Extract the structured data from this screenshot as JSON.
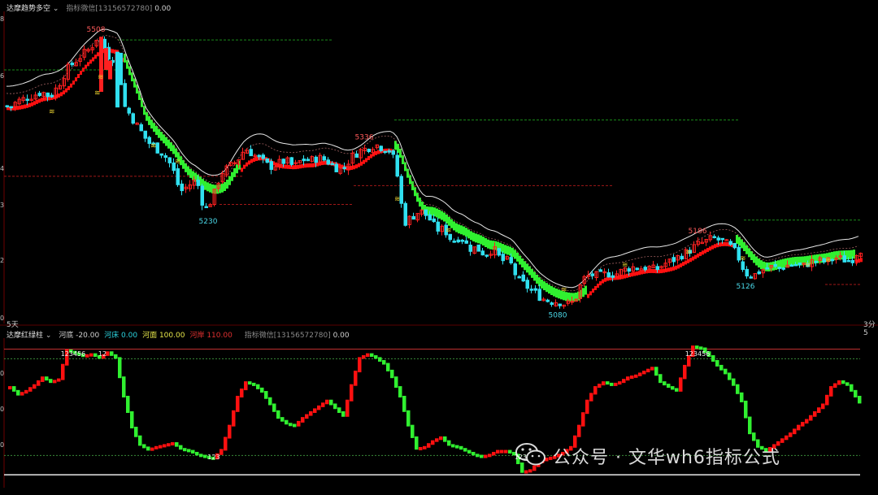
{
  "top_panel": {
    "indicator_name": "达摩趋势多空",
    "source_label": "指标微信[13156572780]",
    "value": "0.00",
    "period_label": "5天",
    "right_label": "3分5",
    "y_ticks": [
      "8",
      "6",
      "4",
      "3",
      "2",
      "0"
    ],
    "peak_labels": [
      "5508",
      "5336",
      "5186"
    ],
    "trough_labels": [
      "5230",
      "5080",
      "5126"
    ]
  },
  "bottom_panel": {
    "indicator_name": "达摩红绿柱",
    "items": [
      {
        "name": "河底",
        "value": "-20.00",
        "color": "#d0d0d0"
      },
      {
        "name": "河床",
        "value": "0.00",
        "color": "#2bd4e0"
      },
      {
        "name": "河面",
        "value": "100.00",
        "color": "#e6e64a"
      },
      {
        "name": "河岸",
        "value": "110.00",
        "color": "#e03030"
      }
    ],
    "source_label": "指标微信[13156572780]",
    "value": "0.00",
    "y_ticks": [
      "0",
      "0",
      "0"
    ],
    "count_labels": [
      "123456",
      "12",
      "123",
      "123456",
      "123456"
    ]
  },
  "watermark": "公众号 · 文华wh6指标公式",
  "colors": {
    "up": "#ff2020",
    "down": "#30e0f0",
    "band_green": "#30f030",
    "band_red": "#ff1010",
    "grid_red": "#6e0000",
    "level_green": "#1a8a1a",
    "level_red": "#a01818"
  },
  "chart_data": [
    {
      "type": "candlestick",
      "title": "达摩趋势多空",
      "note_levels": "price index (approx.)",
      "close_path": [
        [
          0,
          5400
        ],
        [
          10,
          5395
        ],
        [
          20,
          5405
        ],
        [
          30,
          5410
        ],
        [
          40,
          5415
        ],
        [
          50,
          5420
        ],
        [
          60,
          5412
        ],
        [
          70,
          5430
        ],
        [
          80,
          5455
        ],
        [
          90,
          5468
        ],
        [
          100,
          5480
        ],
        [
          110,
          5490
        ],
        [
          118,
          5508
        ],
        [
          125,
          5495
        ],
        [
          135,
          5470
        ],
        [
          143,
          5484
        ],
        [
          150,
          5400
        ],
        [
          160,
          5380
        ],
        [
          170,
          5360
        ],
        [
          180,
          5340
        ],
        [
          190,
          5330
        ],
        [
          200,
          5320
        ],
        [
          210,
          5300
        ],
        [
          220,
          5260
        ],
        [
          230,
          5270
        ],
        [
          240,
          5280
        ],
        [
          250,
          5230
        ],
        [
          260,
          5250
        ],
        [
          270,
          5290
        ],
        [
          280,
          5300
        ],
        [
          290,
          5310
        ],
        [
          300,
          5330
        ],
        [
          310,
          5320
        ],
        [
          320,
          5310
        ],
        [
          330,
          5300
        ],
        [
          340,
          5305
        ],
        [
          350,
          5310
        ],
        [
          360,
          5300
        ],
        [
          370,
          5312
        ],
        [
          380,
          5310
        ],
        [
          390,
          5315
        ],
        [
          400,
          5310
        ],
        [
          410,
          5300
        ],
        [
          420,
          5295
        ],
        [
          430,
          5315
        ],
        [
          440,
          5325
        ],
        [
          450,
          5330
        ],
        [
          460,
          5336
        ],
        [
          470,
          5330
        ],
        [
          480,
          5326
        ],
        [
          488,
          5280
        ],
        [
          495,
          5210
        ],
        [
          505,
          5220
        ],
        [
          515,
          5230
        ],
        [
          525,
          5220
        ],
        [
          535,
          5200
        ],
        [
          545,
          5200
        ],
        [
          555,
          5180
        ],
        [
          565,
          5190
        ],
        [
          575,
          5170
        ],
        [
          585,
          5170
        ],
        [
          595,
          5160
        ],
        [
          605,
          5170
        ],
        [
          615,
          5150
        ],
        [
          625,
          5150
        ],
        [
          635,
          5120
        ],
        [
          645,
          5110
        ],
        [
          655,
          5100
        ],
        [
          665,
          5090
        ],
        [
          675,
          5085
        ],
        [
          685,
          5085
        ],
        [
          695,
          5080
        ],
        [
          705,
          5085
        ],
        [
          715,
          5120
        ],
        [
          725,
          5128
        ],
        [
          735,
          5125
        ],
        [
          745,
          5130
        ],
        [
          755,
          5128
        ],
        [
          765,
          5135
        ],
        [
          775,
          5140
        ],
        [
          785,
          5138
        ],
        [
          795,
          5140
        ],
        [
          805,
          5135
        ],
        [
          815,
          5145
        ],
        [
          825,
          5150
        ],
        [
          835,
          5158
        ],
        [
          845,
          5165
        ],
        [
          855,
          5175
        ],
        [
          865,
          5180
        ],
        [
          875,
          5186
        ],
        [
          885,
          5182
        ],
        [
          895,
          5175
        ],
        [
          905,
          5160
        ],
        [
          915,
          5130
        ],
        [
          925,
          5126
        ],
        [
          935,
          5135
        ],
        [
          945,
          5140
        ],
        [
          955,
          5138
        ],
        [
          965,
          5142
        ],
        [
          975,
          5145
        ],
        [
          985,
          5140
        ],
        [
          995,
          5148
        ],
        [
          1005,
          5150
        ],
        [
          1015,
          5148
        ],
        [
          1025,
          5155
        ],
        [
          1035,
          5152
        ],
        [
          1045,
          5150
        ],
        [
          1055,
          5168
        ]
      ],
      "peaks": [
        {
          "x": 118,
          "value": 5508
        },
        {
          "x": 448,
          "value": 5336
        },
        {
          "x": 858,
          "value": 5186
        }
      ],
      "troughs": [
        {
          "x": 256,
          "value": 5230
        },
        {
          "x": 686,
          "value": 5080
        },
        {
          "x": 917,
          "value": 5126
        }
      ]
    },
    {
      "type": "bar",
      "title": "达摩红绿柱",
      "reference_lines": {
        "河底": -20,
        "河床": 0,
        "河面": 100,
        "河岸": 110
      },
      "ylim": [
        -20,
        110
      ],
      "oscillator": [
        [
          10,
          70
        ],
        [
          20,
          62
        ],
        [
          30,
          66
        ],
        [
          40,
          72
        ],
        [
          50,
          80
        ],
        [
          60,
          75
        ],
        [
          70,
          78
        ],
        [
          80,
          108
        ],
        [
          90,
          105
        ],
        [
          100,
          102
        ],
        [
          110,
          104
        ],
        [
          120,
          100
        ],
        [
          130,
          106
        ],
        [
          140,
          100
        ],
        [
          150,
          60
        ],
        [
          160,
          28
        ],
        [
          170,
          10
        ],
        [
          180,
          5
        ],
        [
          190,
          8
        ],
        [
          200,
          10
        ],
        [
          210,
          12
        ],
        [
          220,
          6
        ],
        [
          230,
          4
        ],
        [
          240,
          0
        ],
        [
          250,
          -2
        ],
        [
          260,
          -4
        ],
        [
          270,
          5
        ],
        [
          280,
          30
        ],
        [
          290,
          60
        ],
        [
          300,
          75
        ],
        [
          310,
          72
        ],
        [
          320,
          65
        ],
        [
          330,
          52
        ],
        [
          340,
          38
        ],
        [
          350,
          32
        ],
        [
          360,
          30
        ],
        [
          370,
          38
        ],
        [
          380,
          44
        ],
        [
          390,
          50
        ],
        [
          400,
          56
        ],
        [
          410,
          48
        ],
        [
          420,
          40
        ],
        [
          430,
          72
        ],
        [
          440,
          100
        ],
        [
          450,
          104
        ],
        [
          460,
          100
        ],
        [
          470,
          94
        ],
        [
          480,
          80
        ],
        [
          490,
          60
        ],
        [
          500,
          30
        ],
        [
          510,
          6
        ],
        [
          520,
          8
        ],
        [
          530,
          14
        ],
        [
          540,
          18
        ],
        [
          550,
          10
        ],
        [
          560,
          8
        ],
        [
          570,
          4
        ],
        [
          580,
          0
        ],
        [
          590,
          -2
        ],
        [
          600,
          0
        ],
        [
          610,
          4
        ],
        [
          620,
          4
        ],
        [
          630,
          0
        ],
        [
          640,
          -18
        ],
        [
          650,
          -16
        ],
        [
          660,
          -8
        ],
        [
          670,
          -4
        ],
        [
          680,
          -2
        ],
        [
          690,
          2
        ],
        [
          700,
          8
        ],
        [
          710,
          30
        ],
        [
          720,
          56
        ],
        [
          730,
          70
        ],
        [
          740,
          75
        ],
        [
          750,
          72
        ],
        [
          760,
          75
        ],
        [
          770,
          80
        ],
        [
          780,
          82
        ],
        [
          790,
          86
        ],
        [
          800,
          90
        ],
        [
          810,
          75
        ],
        [
          820,
          70
        ],
        [
          830,
          66
        ],
        [
          840,
          92
        ],
        [
          850,
          112
        ],
        [
          860,
          110
        ],
        [
          870,
          102
        ],
        [
          880,
          92
        ],
        [
          890,
          84
        ],
        [
          900,
          72
        ],
        [
          910,
          55
        ],
        [
          920,
          22
        ],
        [
          930,
          8
        ],
        [
          940,
          4
        ],
        [
          950,
          10
        ],
        [
          960,
          16
        ],
        [
          970,
          22
        ],
        [
          980,
          30
        ],
        [
          990,
          36
        ],
        [
          1000,
          44
        ],
        [
          1010,
          52
        ],
        [
          1020,
          70
        ],
        [
          1030,
          76
        ],
        [
          1040,
          72
        ],
        [
          1050,
          60
        ],
        [
          1058,
          50
        ]
      ]
    }
  ]
}
